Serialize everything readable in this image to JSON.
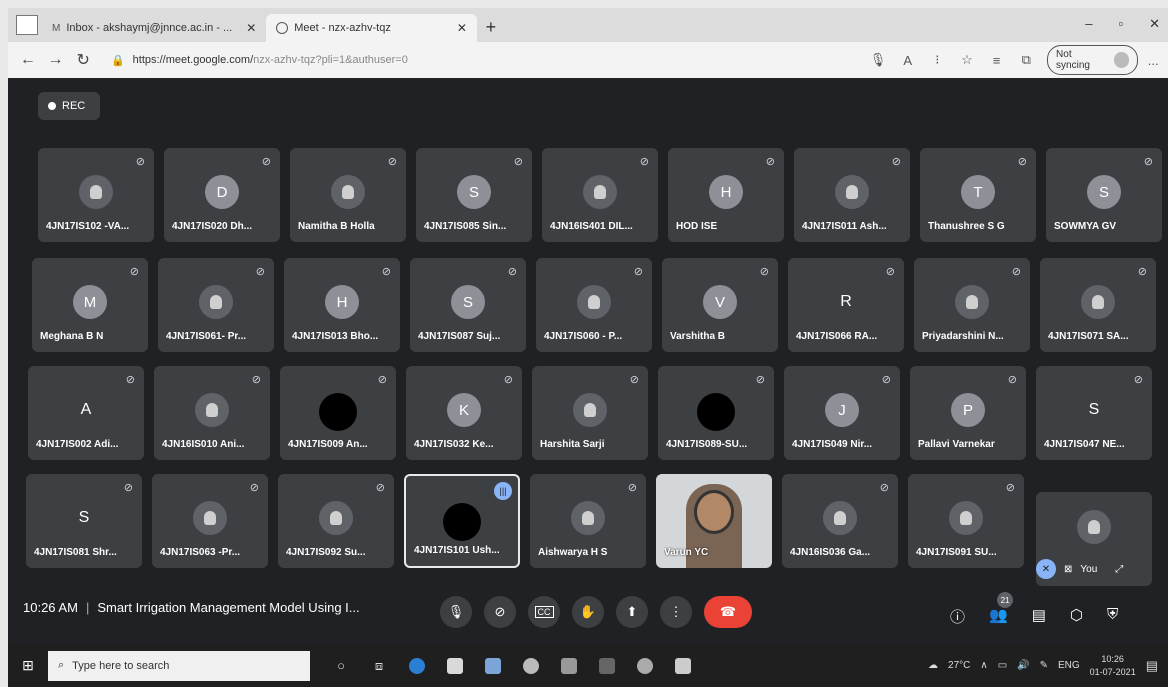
{
  "browser": {
    "tabs": [
      {
        "label": "Inbox - akshaymj@jnnce.ac.in - ...",
        "active": false
      },
      {
        "label": "Meet - nzx-azhv-tqz",
        "active": true
      }
    ],
    "url_host": "https://meet.google.com/",
    "url_path": "nzx-azhv-tqz?pli=1&authuser=0",
    "sync_label": "Not syncing",
    "more_label": "..."
  },
  "meet": {
    "rec_label": "REC",
    "time": "10:26 AM",
    "meeting_title": "Smart Irrigation Management Model Using I...",
    "people_count": "21",
    "you_label": "You",
    "participants": [
      {
        "name": "4JN17IS102 -VA...",
        "type": "photo",
        "letter": ""
      },
      {
        "name": "4JN17IS020 Dh...",
        "type": "letter",
        "letter": "D"
      },
      {
        "name": "Namitha B Holla",
        "type": "photo",
        "letter": ""
      },
      {
        "name": "4JN17IS085 Sin...",
        "type": "letter",
        "letter": "S"
      },
      {
        "name": "4JN16IS401 DIL...",
        "type": "photo",
        "letter": ""
      },
      {
        "name": "HOD ISE",
        "type": "letter",
        "letter": "H"
      },
      {
        "name": "4JN17IS011 Ash...",
        "type": "photo",
        "letter": ""
      },
      {
        "name": "Thanushree S G",
        "type": "letter",
        "letter": "T"
      },
      {
        "name": "SOWMYA GV",
        "type": "letter",
        "letter": "S"
      },
      {
        "name": "Meghana B N",
        "type": "letter",
        "letter": "M"
      },
      {
        "name": "4JN17IS061- Pr...",
        "type": "photo",
        "letter": ""
      },
      {
        "name": "4JN17IS013 Bho...",
        "type": "letter",
        "letter": "H"
      },
      {
        "name": "4JN17IS087 Suj...",
        "type": "letter",
        "letter": "S"
      },
      {
        "name": "4JN17IS060 - P...",
        "type": "photo",
        "letter": ""
      },
      {
        "name": "Varshitha B",
        "type": "letter",
        "letter": "V"
      },
      {
        "name": "4JN17IS066 RA...",
        "type": "plain",
        "letter": "R"
      },
      {
        "name": "Priyadarshini N...",
        "type": "photo",
        "letter": ""
      },
      {
        "name": "4JN17IS071 SA...",
        "type": "photo",
        "letter": ""
      },
      {
        "name": "4JN17IS002 Adi...",
        "type": "plain",
        "letter": "A"
      },
      {
        "name": "4JN16IS010 Ani...",
        "type": "photo",
        "letter": ""
      },
      {
        "name": "4JN17IS009 An...",
        "type": "black",
        "letter": ""
      },
      {
        "name": "4JN17IS032 Ke...",
        "type": "letter",
        "letter": "K"
      },
      {
        "name": "Harshita Sarji",
        "type": "photo",
        "letter": ""
      },
      {
        "name": "4JN17IS089-SU...",
        "type": "black",
        "letter": ""
      },
      {
        "name": "4JN17IS049 Nir...",
        "type": "letter",
        "letter": "J"
      },
      {
        "name": "Pallavi Varnekar",
        "type": "letter",
        "letter": "P"
      },
      {
        "name": "4JN17IS047 NE...",
        "type": "plain",
        "letter": "S"
      },
      {
        "name": "4JN17IS081 Shr...",
        "type": "plain",
        "letter": "S"
      },
      {
        "name": "4JN17IS063 -Pr...",
        "type": "photo",
        "letter": ""
      },
      {
        "name": "4JN17IS092 Su...",
        "type": "photo",
        "letter": ""
      },
      {
        "name": "4JN17IS101 Ush...",
        "type": "black",
        "letter": ""
      },
      {
        "name": "Aishwarya H S",
        "type": "photo",
        "letter": ""
      },
      {
        "name": "Varun YC",
        "type": "video",
        "letter": ""
      },
      {
        "name": "4JN16IS036 Ga...",
        "type": "photo",
        "letter": ""
      },
      {
        "name": "4JN17IS091 SU...",
        "type": "photo",
        "letter": ""
      }
    ]
  },
  "taskbar": {
    "search_placeholder": "Type here to search",
    "temperature": "27°C",
    "language": "ENG",
    "clock_time": "10:26",
    "clock_date": "01-07-2021"
  }
}
